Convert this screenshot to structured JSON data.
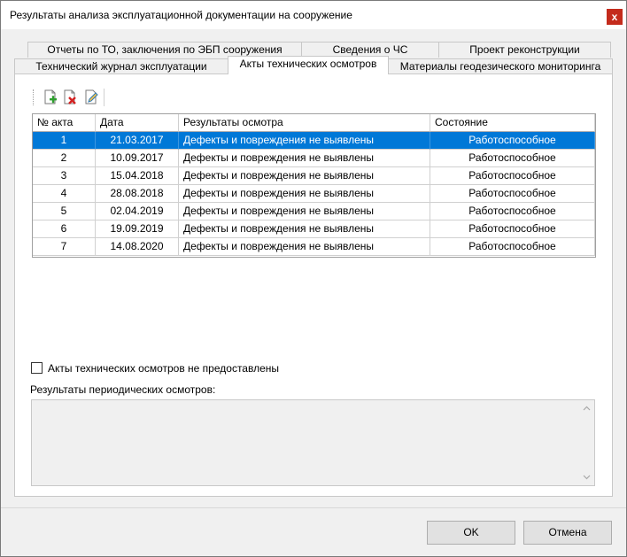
{
  "window": {
    "title": "Результаты анализа эксплуатационной документации на сооружение",
    "close_label": "x"
  },
  "tabs": {
    "row1": [
      "Отчеты по ТО, заключения по ЭБП сооружения",
      "Сведения о ЧС",
      "Проект реконструкции"
    ],
    "row2": [
      "Технический журнал эксплуатации",
      "Акты технических осмотров",
      "Материалы геодезического мониторинга"
    ],
    "active": "Акты технических осмотров"
  },
  "toolbar": {
    "buttons": [
      "add-record-icon",
      "delete-record-icon",
      "edit-record-icon"
    ]
  },
  "table": {
    "columns": [
      "№ акта",
      "Дата",
      "Результаты осмотра",
      "Состояние"
    ],
    "rows": [
      [
        "1",
        "21.03.2017",
        "Дефекты и повреждения не выявлены",
        "Работоспособное"
      ],
      [
        "2",
        "10.09.2017",
        "Дефекты и повреждения не выявлены",
        "Работоспособное"
      ],
      [
        "3",
        "15.04.2018",
        "Дефекты и повреждения не выявлены",
        "Работоспособное"
      ],
      [
        "4",
        "28.08.2018",
        "Дефекты и повреждения не выявлены",
        "Работоспособное"
      ],
      [
        "5",
        "02.04.2019",
        "Дефекты и повреждения не выявлены",
        "Работоспособное"
      ],
      [
        "6",
        "19.09.2019",
        "Дефекты и повреждения не выявлены",
        "Работоспособное"
      ],
      [
        "7",
        "14.08.2020",
        "Дефекты и повреждения не выявлены",
        "Работоспособное"
      ]
    ],
    "selected_row": 0
  },
  "not_provided_checkbox": {
    "label": "Акты технических осмотров не предоставлены",
    "checked": false
  },
  "periodic": {
    "label": "Результаты периодических осмотров:",
    "value": ""
  },
  "buttons": {
    "ok": "OK",
    "cancel": "Отмена"
  },
  "colors": {
    "selection": "#0078d7",
    "close": "#c42b1c"
  }
}
